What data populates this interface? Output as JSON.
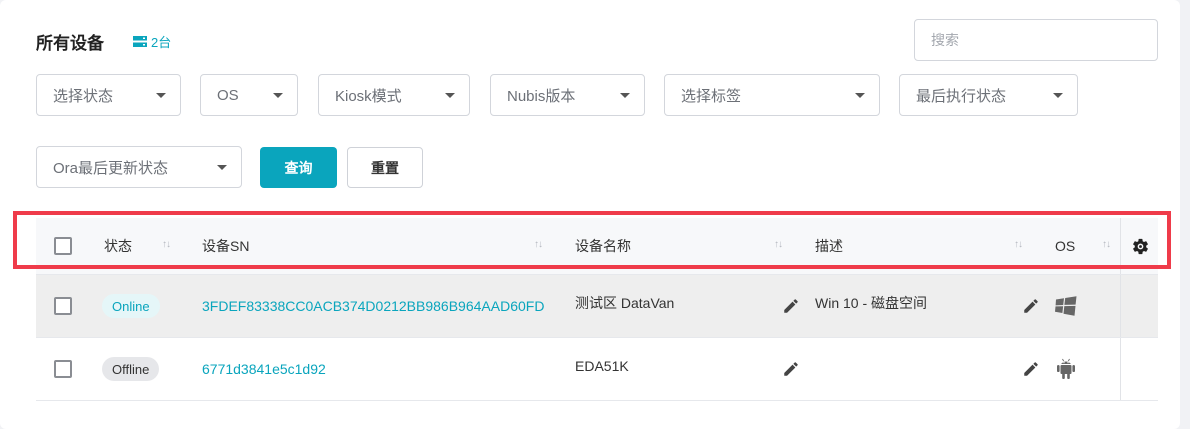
{
  "header": {
    "title": "所有设备",
    "count": "2台",
    "icon": "server-icon"
  },
  "search": {
    "placeholder": "搜索"
  },
  "filters": {
    "status": "选择状态",
    "os": "OS",
    "kiosk": "Kiosk模式",
    "nubis": "Nubis版本",
    "tags": "选择标签",
    "last_exec": "最后执行状态",
    "ora_update": "Ora最后更新状态"
  },
  "buttons": {
    "query": "查询",
    "reset": "重置"
  },
  "table": {
    "columns": {
      "status": "状态",
      "sn": "设备SN",
      "name": "设备名称",
      "desc": "描述",
      "os": "OS"
    },
    "sort_glyph": "↑↓",
    "rows": [
      {
        "status": "Online",
        "sn": "3FDEF83338CC0ACB374D0212BB986B964AAD60FD",
        "name": "测试区 DataVan",
        "desc": "Win 10 - 磁盘空间",
        "os_icon": "windows-icon"
      },
      {
        "status": "Offline",
        "sn": "6771d3841e5c1d92",
        "name": "EDA51K",
        "desc": "",
        "os_icon": "android-icon"
      }
    ]
  },
  "colors": {
    "accent": "#0aa5bd",
    "highlight": "#ef3b4a"
  }
}
